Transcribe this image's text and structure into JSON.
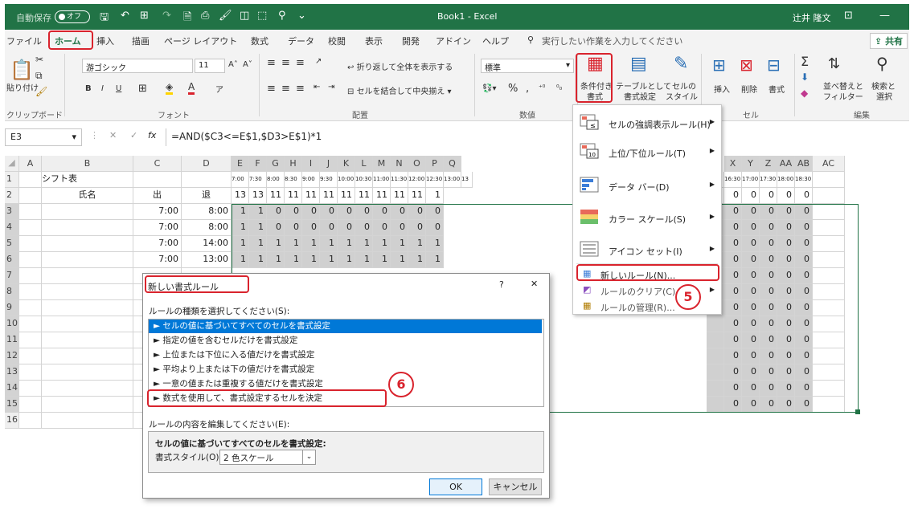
{
  "titlebar": {
    "autosave": "自動保存",
    "autosave_toggle": "オフ",
    "title": "Book1 - Excel",
    "user": "辻井 隆文"
  },
  "tabs": [
    "ファイル",
    "ホーム",
    "挿入",
    "描画",
    "ページ レイアウト",
    "数式",
    "データ",
    "校閲",
    "表示",
    "開発",
    "アドイン",
    "ヘルプ"
  ],
  "search_placeholder": "実行したい作業を入力してください",
  "share": "共有",
  "ribbon": {
    "clipboard": {
      "paste": "貼り付け",
      "label": "クリップボード"
    },
    "font": {
      "name": "游ゴシック",
      "size": "11",
      "label": "フォント",
      "bold": "B",
      "italic": "I",
      "underline": "U"
    },
    "alignment": {
      "wrap": "折り返して全体を表示する",
      "merge": "セルを結合して中央揃え",
      "label": "配置"
    },
    "number": {
      "format": "標準",
      "pct": "%",
      "label": "数値"
    },
    "styles": {
      "cond": "条件付き",
      "cond2": "書式",
      "table": "テーブルとして",
      "table2": "書式設定",
      "cellstyle": "セルの",
      "cellstyle2": "スタイル"
    },
    "cells": {
      "insert": "挿入",
      "delete": "削除",
      "format": "書式",
      "label": "セル"
    },
    "editing": {
      "sort": "並べ替えと",
      "sort2": "フィルター",
      "find": "検索と",
      "find2": "選択",
      "label": "編集"
    }
  },
  "formula": {
    "namebox": "E3",
    "fx": "fx",
    "value": "=AND($C3<=E$1,$D3>E$1)*1"
  },
  "sheet": {
    "col_headers": [
      "A",
      "B",
      "C",
      "D",
      "E",
      "F",
      "G",
      "H",
      "I",
      "J",
      "K",
      "L",
      "M",
      "N",
      "O",
      "P",
      "Q",
      "X",
      "Y",
      "Z",
      "AA",
      "AB",
      "AC"
    ],
    "times_left": [
      "7:00",
      "7:30",
      "8:00",
      "8:30",
      "9:00",
      "9:30",
      "10:00",
      "10:30",
      "11:00",
      "11:30",
      "12:00",
      "12:30",
      "13:00",
      "13"
    ],
    "times_right": [
      "16:30",
      "17:00",
      "17:30",
      "18:00",
      "18:30"
    ],
    "row_headers": [
      "1",
      "2",
      "3",
      "4",
      "5",
      "6",
      "7",
      "8",
      "9",
      "10",
      "11",
      "12",
      "13",
      "14",
      "15",
      "16"
    ],
    "b1": "シフト表",
    "b2": "氏名",
    "c2": "出",
    "d2": "退",
    "row2_left": [
      "13",
      "13",
      "11",
      "11",
      "11",
      "11",
      "11",
      "11",
      "11",
      "11",
      "11",
      "1"
    ],
    "rows_c": [
      "7:00",
      "7:00",
      "7:00",
      "7:00"
    ],
    "rows_d": [
      "8:00",
      "8:00",
      "14:00",
      "13:00"
    ],
    "row3": [
      "1",
      "1",
      "0",
      "0",
      "0",
      "0",
      "0",
      "0",
      "0",
      "0",
      "0",
      "0"
    ],
    "row4": [
      "1",
      "1",
      "0",
      "0",
      "0",
      "0",
      "0",
      "0",
      "0",
      "0",
      "0",
      "0"
    ],
    "row5": [
      "1",
      "1",
      "1",
      "1",
      "1",
      "1",
      "1",
      "1",
      "1",
      "1",
      "1",
      "1"
    ],
    "row6": [
      "1",
      "1",
      "1",
      "1",
      "1",
      "1",
      "1",
      "1",
      "1",
      "1",
      "1",
      "1"
    ],
    "right_vals": [
      "0",
      "0",
      "0",
      "0",
      "0"
    ]
  },
  "menu": {
    "items": [
      {
        "label": "セルの強調表示ルール(H)"
      },
      {
        "label": "上位/下位ルール(T)"
      },
      {
        "label": "データ バー(D)"
      },
      {
        "label": "カラー スケール(S)"
      },
      {
        "label": "アイコン セット(I)"
      }
    ],
    "new_rule": "新しいルール(N)...",
    "clear": "ルールのクリア(C)",
    "manage": "ルールの管理(R)..."
  },
  "dialog": {
    "title": "新しい書式ルール",
    "help": "?",
    "close": "✕",
    "select_label": "ルールの種類を選択してください(S):",
    "rules": [
      "► セルの値に基づいてすべてのセルを書式設定",
      "► 指定の値を含むセルだけを書式設定",
      "► 上位または下位に入る値だけを書式設定",
      "► 平均より上または下の値だけを書式設定",
      "► 一意の値または重複する値だけを書式設定",
      "► 数式を使用して、書式設定するセルを決定"
    ],
    "edit_label": "ルールの内容を編集してください(E):",
    "desc_title": "セルの値に基づいてすべてのセルを書式設定:",
    "style_label": "書式スタイル(O):",
    "style_value": "2 色スケール",
    "ok": "OK",
    "cancel": "キャンセル"
  },
  "callouts": {
    "five": "5",
    "six": "6"
  }
}
